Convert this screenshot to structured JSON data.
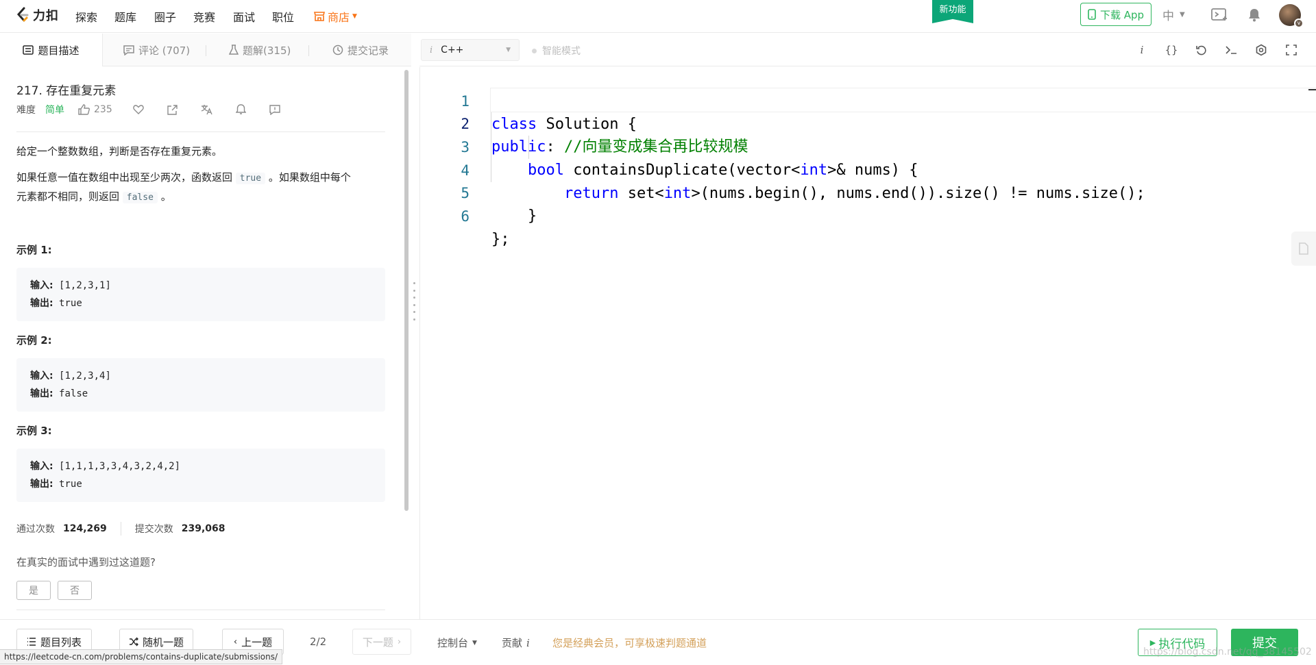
{
  "nav": {
    "logo_text": "力扣",
    "items": [
      "探索",
      "题库",
      "圈子",
      "竞赛",
      "面试",
      "职位"
    ],
    "shop": "商店",
    "new_badge": "新功能",
    "download_app": "下载 App",
    "language": "中"
  },
  "left_tabs": {
    "description": "题目描述",
    "comments": "评论 (707)",
    "solutions": "题解(315)",
    "submissions": "提交记录"
  },
  "problem": {
    "title": "217. 存在重复元素",
    "difficulty_label": "难度",
    "difficulty": "简单",
    "likes": "235",
    "desc1": "给定一个整数数组，判断是否存在重复元素。",
    "desc2_a": "如果任意一值在数组中出现至少两次，函数返回 ",
    "desc2_code_true": "true",
    "desc2_b": " 。如果数组中每个",
    "desc2_c": "元素都不相同，则返回 ",
    "desc2_code_false": "false",
    "desc2_d": " 。",
    "examples": [
      {
        "label": "示例 1:",
        "input_label": "输入:",
        "input": " [1,2,3,1]",
        "output_label": "输出:",
        "output": " true"
      },
      {
        "label": "示例 2:",
        "input_label": "输入:",
        "input": " [1,2,3,4]",
        "output_label": "输出:",
        "output": " false"
      },
      {
        "label": "示例 3:",
        "input_label": "输入:",
        "input": " [1,1,1,3,3,4,3,2,4,2]",
        "output_label": "输出:",
        "output": " true"
      }
    ],
    "accepted_label": "通过次数",
    "accepted": "124,269",
    "submissions_label": "提交次数",
    "submissions": "239,068",
    "interview_question": "在真实的面试中遇到过这道题?",
    "yes": "是",
    "no": "否"
  },
  "editor": {
    "language": "C++",
    "smart_mode": "智能模式",
    "line_numbers": [
      "1",
      "2",
      "3",
      "4",
      "5",
      "6"
    ],
    "code": {
      "l1_kw": "class",
      "l1_rest": " Solution {",
      "l2_kw": "public",
      "l2_mid": ": ",
      "l2_comment": "//向量变成集合再比较规模",
      "l3_indent": "    ",
      "l3_kw": "bool",
      "l3_a": " containsDuplicate(vector<",
      "l3_kw2": "int",
      "l3_b": ">& nums) {",
      "l4_indent": "        ",
      "l4_kw": "return",
      "l4_a": " set<",
      "l4_kw2": "int",
      "l4_b": ">(nums.begin(), nums.end()).size() != nums.size();",
      "l5": "    }",
      "l6": "};"
    }
  },
  "bottom": {
    "problem_list": "题目列表",
    "random": "随机一题",
    "prev": "上一题",
    "pager": "2/2",
    "next": "下一题",
    "console": "控制台",
    "contribute": "贡献",
    "member_notice": "您是经典会员，可享极速判题通道",
    "run": "执行代码",
    "submit": "提交"
  },
  "status_url": "https://leetcode-cn.com/problems/contains-duplicate/submissions/",
  "watermark": "https://blog.csdn.net/qq_38145502",
  "colors": {
    "accent_green": "#2db55d",
    "shop_orange": "#f97316",
    "badge_green": "#0ca678",
    "keyword_blue": "#0000ff",
    "comment_green": "#008000",
    "member_gold": "#d4a15b"
  }
}
